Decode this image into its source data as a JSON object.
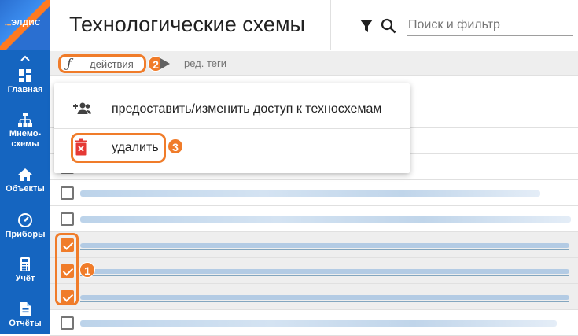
{
  "logo": {
    "text": "ЭЛДИС"
  },
  "sidebar": {
    "collapse_icon": "chevron-up-icon",
    "items": [
      {
        "label": "Главная",
        "icon": "dashboard-icon"
      },
      {
        "label": "Мнемо-",
        "label2": "схемы",
        "icon": "sitemap-icon"
      },
      {
        "label": "Объекты",
        "icon": "home-icon"
      },
      {
        "label": "Приборы",
        "icon": "gauge-icon"
      },
      {
        "label": "Учёт",
        "icon": "calculator-icon"
      },
      {
        "label": "Отчёты",
        "icon": "document-icon"
      }
    ]
  },
  "header": {
    "title": "Технологические схемы",
    "filter_icon": "filter-icon",
    "search_icon": "search-icon",
    "search_placeholder": "Поиск и фильтр"
  },
  "toolbar": {
    "actions_label": "действия",
    "actions_icon": "function-icon",
    "tags_label": "ред. теги",
    "tags_icon": "tag-icon"
  },
  "menu": {
    "items": [
      {
        "label": "предоставить/изменить доступ к техносхемам",
        "icon": "people-add-icon"
      },
      {
        "label": "удалить",
        "icon": "delete-icon"
      }
    ]
  },
  "annotations": {
    "step1": "1",
    "step2": "2",
    "step3": "3"
  },
  "colors": {
    "sidebar": "#1565c0",
    "accent": "#f07c2a",
    "delete": "#e53935"
  },
  "rows": [
    {
      "checked": false
    },
    {
      "checked": false
    },
    {
      "checked": false
    },
    {
      "checked": false
    },
    {
      "checked": false
    },
    {
      "checked": false
    },
    {
      "checked": true
    },
    {
      "checked": true
    },
    {
      "checked": true
    },
    {
      "checked": false
    }
  ]
}
